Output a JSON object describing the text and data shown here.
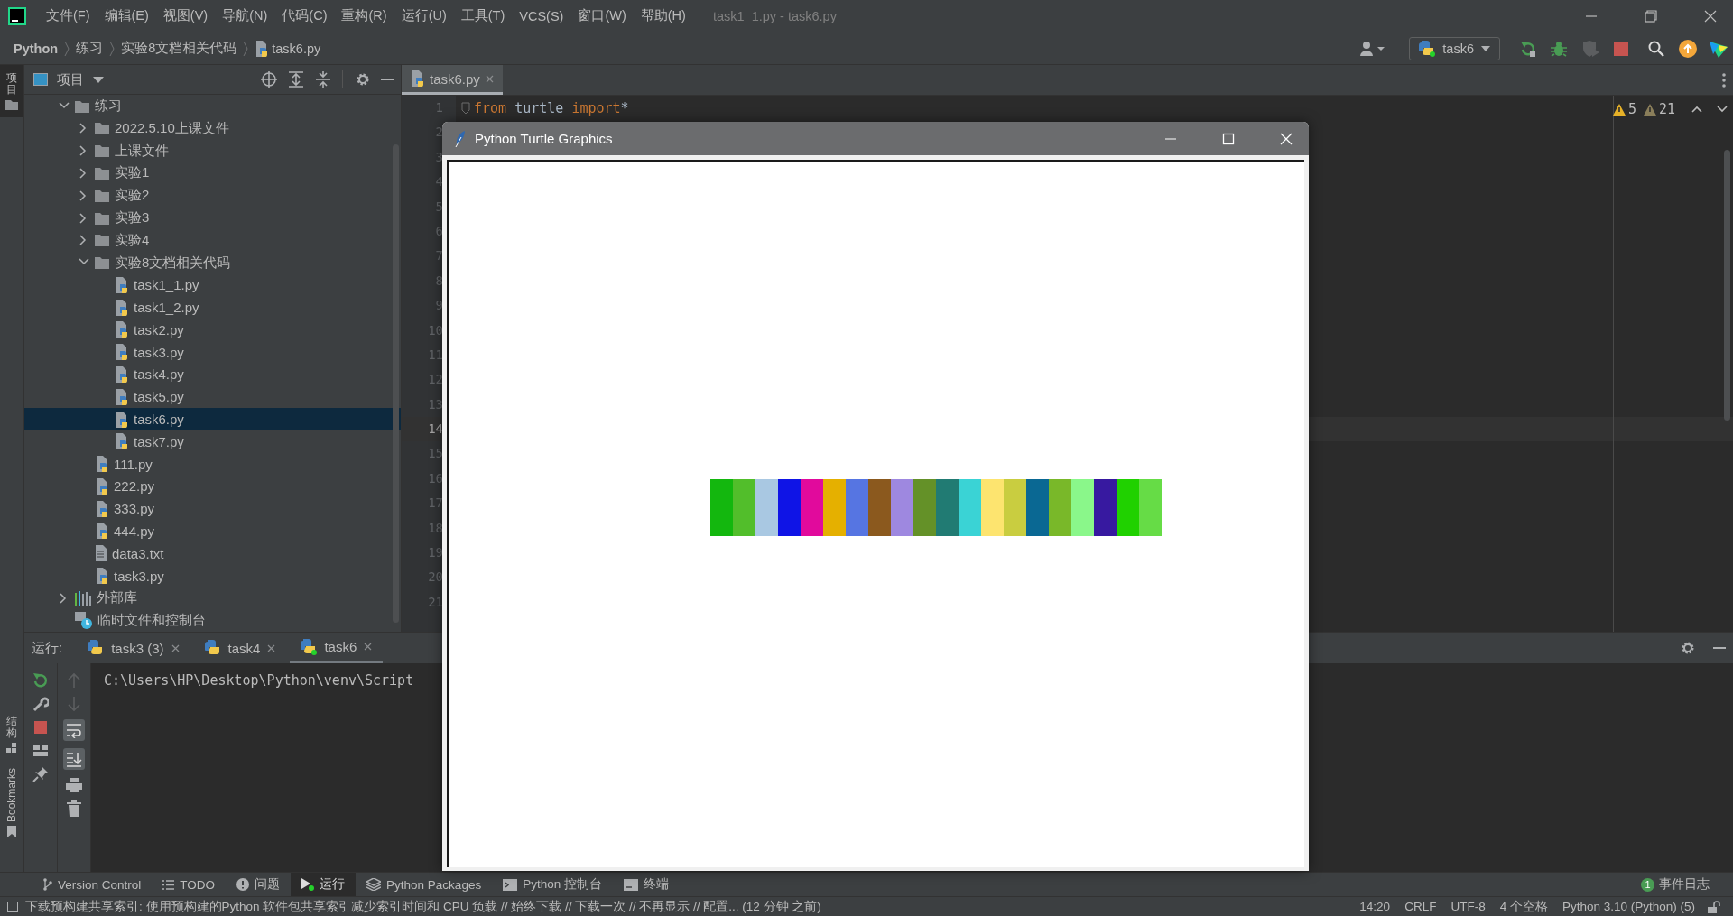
{
  "menu_bar": {
    "items": [
      "文件(F)",
      "编辑(E)",
      "视图(V)",
      "导航(N)",
      "代码(C)",
      "重构(R)",
      "运行(U)",
      "工具(T)",
      "VCS(S)",
      "窗口(W)",
      "帮助(H)"
    ],
    "title": "task1_1.py - task6.py"
  },
  "breadcrumb": [
    "Python",
    "练习",
    "实验8文档相关代码",
    "task6.py"
  ],
  "run_config": "task6",
  "left_strip": {
    "top": [
      "项目"
    ],
    "bottom": [
      "结构",
      "Bookmarks"
    ]
  },
  "project_panel": {
    "title": "项目",
    "tree": [
      {
        "label": "练习",
        "kind": "folder",
        "expanded": true,
        "selected": false,
        "children": [
          {
            "label": "2022.5.10上课文件",
            "kind": "folder",
            "expanded": false,
            "selected": false
          },
          {
            "label": "上课文件",
            "kind": "folder",
            "expanded": false,
            "selected": false
          },
          {
            "label": "实验1",
            "kind": "folder",
            "expanded": false,
            "selected": false
          },
          {
            "label": "实验2",
            "kind": "folder",
            "expanded": false,
            "selected": false
          },
          {
            "label": "实验3",
            "kind": "folder",
            "expanded": false,
            "selected": false
          },
          {
            "label": "实验4",
            "kind": "folder",
            "expanded": false,
            "selected": false
          },
          {
            "label": "实验8文档相关代码",
            "kind": "folder",
            "expanded": true,
            "selected": false,
            "children": [
              {
                "label": "task1_1.py",
                "kind": "python",
                "selected": false
              },
              {
                "label": "task1_2.py",
                "kind": "python",
                "selected": false
              },
              {
                "label": "task2.py",
                "kind": "python",
                "selected": false
              },
              {
                "label": "task3.py",
                "kind": "python",
                "selected": false
              },
              {
                "label": "task4.py",
                "kind": "python",
                "selected": false
              },
              {
                "label": "task5.py",
                "kind": "python",
                "selected": false
              },
              {
                "label": "task6.py",
                "kind": "python",
                "selected": true
              },
              {
                "label": "task7.py",
                "kind": "python",
                "selected": false
              }
            ]
          },
          {
            "label": "111.py",
            "kind": "python",
            "selected": false
          },
          {
            "label": "222.py",
            "kind": "python",
            "selected": false
          },
          {
            "label": "333.py",
            "kind": "python",
            "selected": false
          },
          {
            "label": "444.py",
            "kind": "python",
            "selected": false
          },
          {
            "label": "data3.txt",
            "kind": "text",
            "selected": false
          },
          {
            "label": "task3.py",
            "kind": "python",
            "selected": false
          }
        ]
      },
      {
        "label": "外部库",
        "kind": "library",
        "expanded": false,
        "selected": false
      },
      {
        "label": "临时文件和控制台",
        "kind": "scratch",
        "selected": false
      }
    ]
  },
  "editor": {
    "tabs": [
      {
        "label": "task6.py",
        "selected": true
      }
    ],
    "warnings": [
      {
        "count": "5",
        "kind": "warning"
      },
      {
        "count": "21",
        "kind": "weak"
      }
    ],
    "lines": [
      {
        "number": "1",
        "current": false,
        "code": [
          {
            "text": "from",
            "kind": "keyword"
          },
          {
            "text": " turtle ",
            "kind": "plain"
          },
          {
            "text": "import",
            "kind": "keyword"
          },
          {
            "text": "*",
            "kind": "plain"
          }
        ]
      },
      {
        "number": "2",
        "current": false
      },
      {
        "number": "3",
        "current": false
      },
      {
        "number": "4",
        "current": false
      },
      {
        "number": "5",
        "current": false
      },
      {
        "number": "6",
        "current": false
      },
      {
        "number": "7",
        "current": false
      },
      {
        "number": "8",
        "current": false
      },
      {
        "number": "9",
        "current": false
      },
      {
        "number": "10",
        "current": false
      },
      {
        "number": "11",
        "current": false
      },
      {
        "number": "12",
        "current": false
      },
      {
        "number": "13",
        "current": false
      },
      {
        "number": "14",
        "current": true
      },
      {
        "number": "15",
        "current": false
      },
      {
        "number": "16",
        "current": false
      },
      {
        "number": "17",
        "current": false
      },
      {
        "number": "18",
        "current": false
      },
      {
        "number": "19",
        "current": false
      },
      {
        "number": "20",
        "current": false
      },
      {
        "number": "21",
        "current": false
      }
    ]
  },
  "run_panel": {
    "label": "运行:",
    "tabs": [
      {
        "label": "task3 (3)",
        "selected": false
      },
      {
        "label": "task4",
        "selected": false
      },
      {
        "label": "task6",
        "selected": true
      }
    ],
    "output": "C:\\Users\\HP\\Desktop\\Python\\venv\\Script"
  },
  "tool_windows": [
    {
      "label": "Version Control",
      "kind": "vcs",
      "selected": false
    },
    {
      "label": "TODO",
      "kind": "todo",
      "selected": false
    },
    {
      "label": "问题",
      "kind": "problems",
      "selected": false
    },
    {
      "label": "运行",
      "kind": "run",
      "selected": true
    },
    {
      "label": "Python Packages",
      "kind": "packages",
      "selected": false
    },
    {
      "label": "Python 控制台",
      "kind": "console",
      "selected": false
    },
    {
      "label": "终端",
      "kind": "terminal",
      "selected": false
    }
  ],
  "event_log": {
    "badge": "1",
    "label": "事件日志"
  },
  "status_bar": {
    "message": "下载预构建共享索引: 使用预构建的Python 软件包共享索引减少索引时间和 CPU 负载 // 始终下载 // 下载一次 // 不再显示 // 配置... (12 分钟 之前)",
    "items": [
      "14:20",
      "CRLF",
      "UTF-8",
      "4 个空格",
      "Python 3.10 (Python) (5)"
    ]
  },
  "turtle_window": {
    "title": "Python Turtle Graphics",
    "stripes": [
      {
        "color": "#13b70e"
      },
      {
        "color": "#52be2b"
      },
      {
        "color": "#a9c8e2"
      },
      {
        "color": "#0f14e6"
      },
      {
        "color": "#e10a9c"
      },
      {
        "color": "#e5b000"
      },
      {
        "color": "#5675e2"
      },
      {
        "color": "#8b591e"
      },
      {
        "color": "#9e88e0"
      },
      {
        "color": "#649128"
      },
      {
        "color": "#217b73"
      },
      {
        "color": "#3ad3d5"
      },
      {
        "color": "#fde46f"
      },
      {
        "color": "#c9cd40"
      },
      {
        "color": "#0a6893"
      },
      {
        "color": "#79b829"
      },
      {
        "color": "#8af78a"
      },
      {
        "color": "#3719a0"
      },
      {
        "color": "#20d100"
      },
      {
        "color": "#66dc46"
      }
    ]
  }
}
